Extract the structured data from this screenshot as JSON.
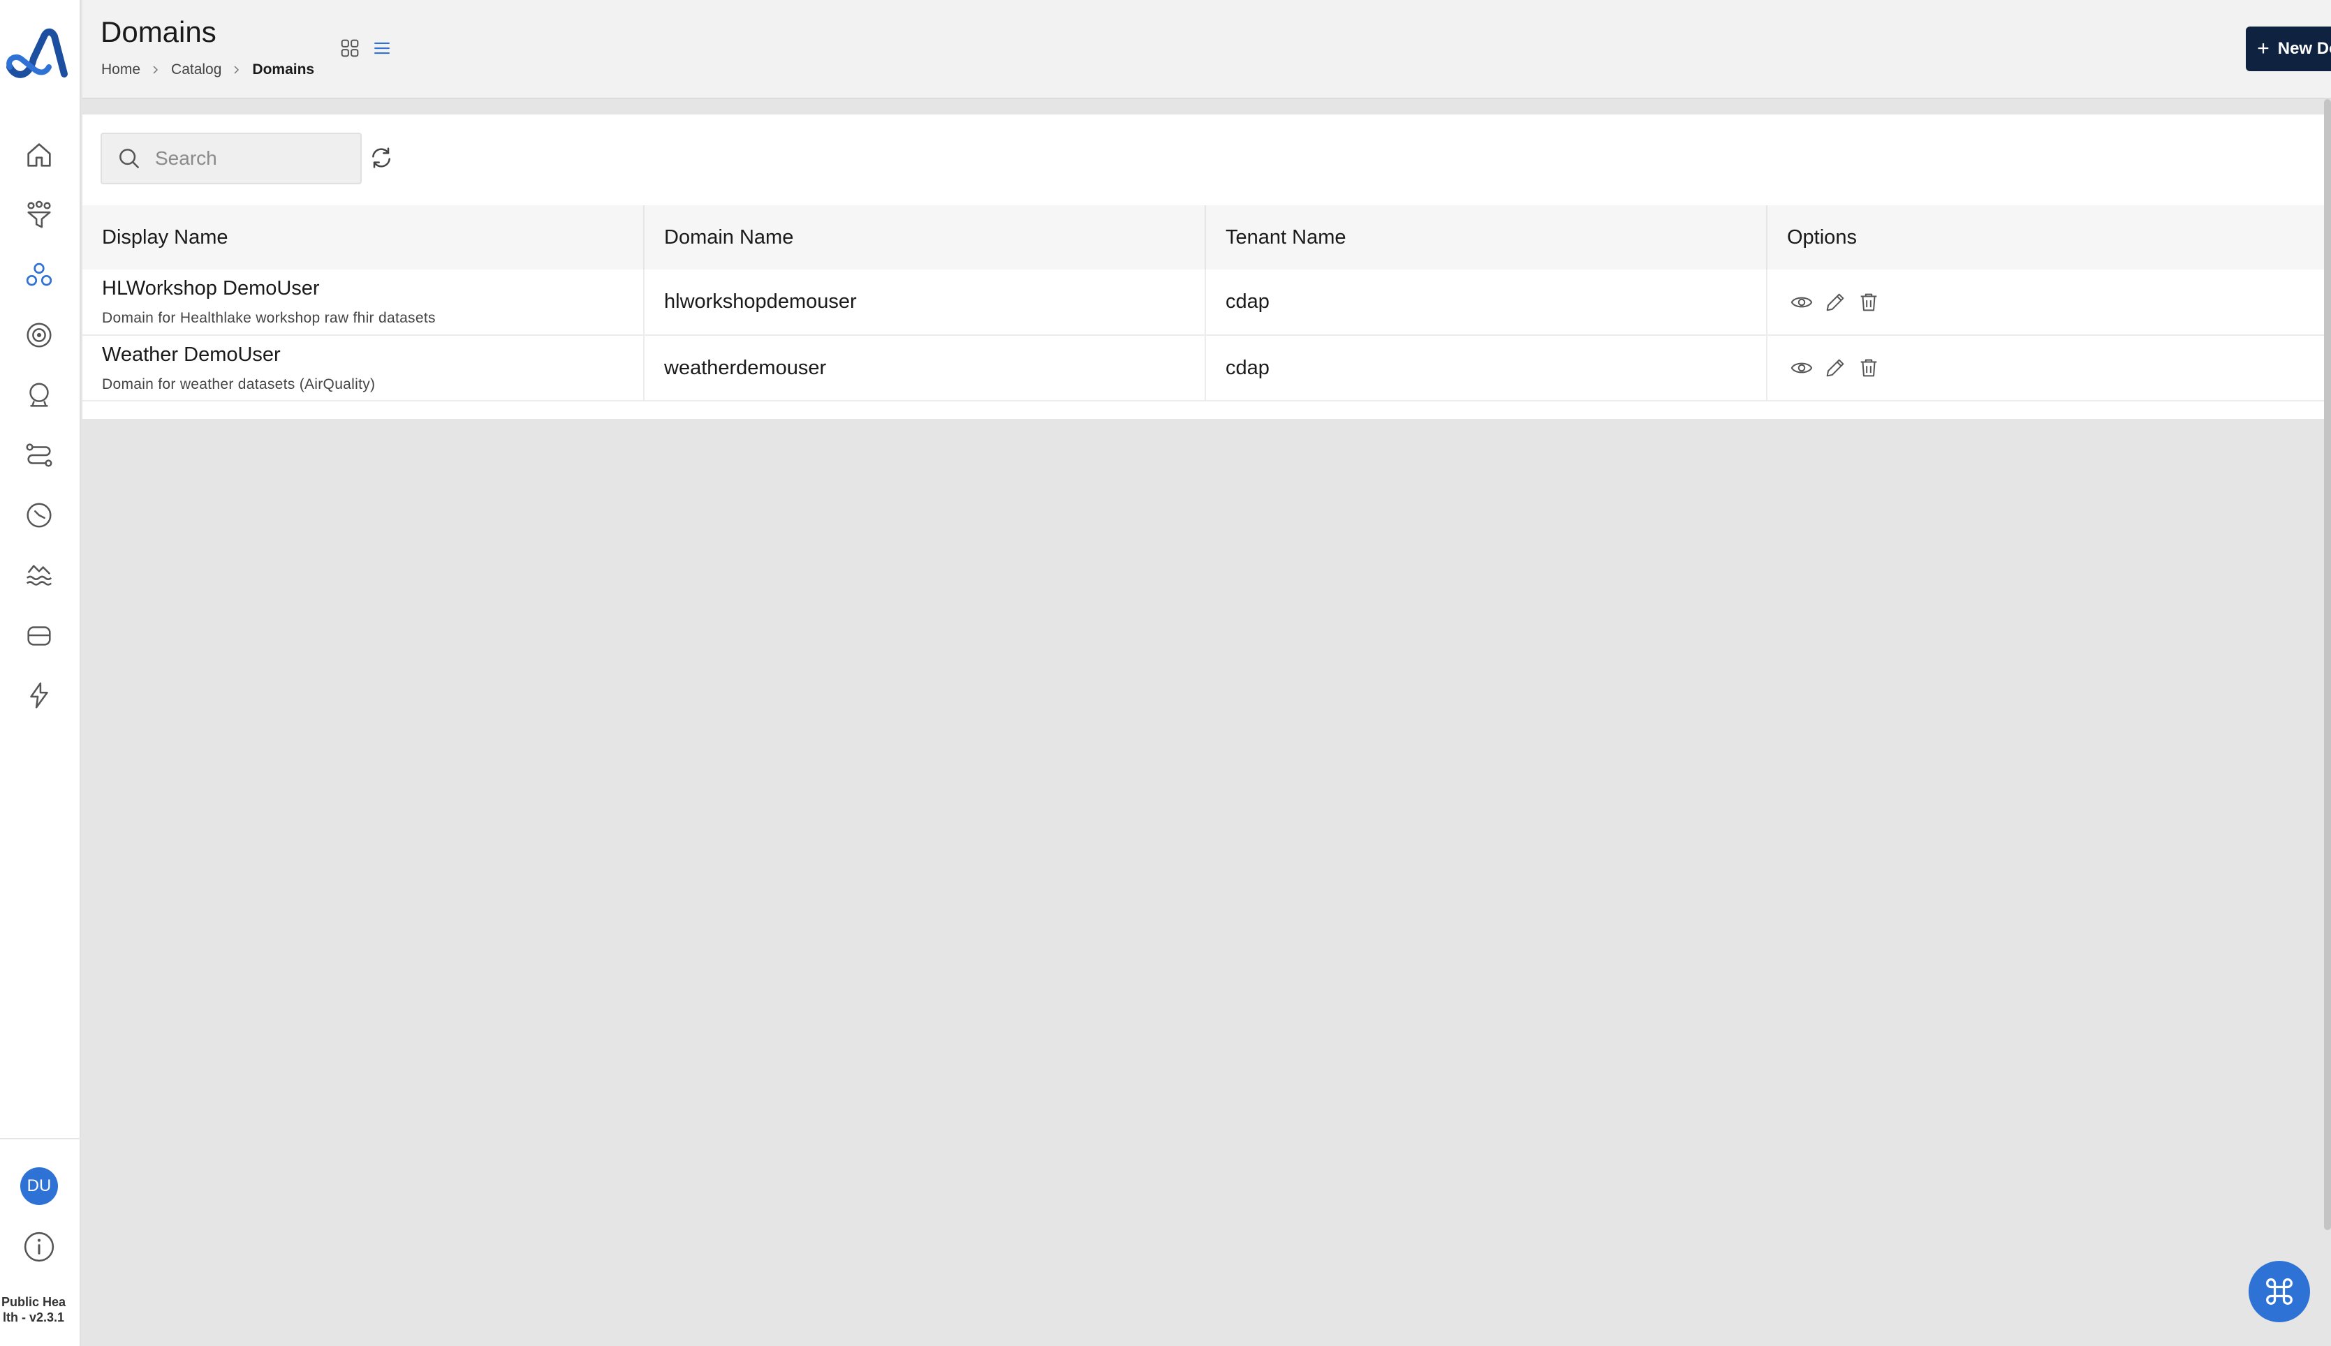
{
  "app": {
    "version_label": "Public Health - v2.3.1",
    "user_initials": "DU"
  },
  "sidebar": {
    "items": [
      {
        "icon": "home-icon",
        "active": false
      },
      {
        "icon": "funnel-people-icon",
        "active": false
      },
      {
        "icon": "domains-icon",
        "active": true
      },
      {
        "icon": "target-icon",
        "active": false
      },
      {
        "icon": "crystal-ball-icon",
        "active": false
      },
      {
        "icon": "workflow-icon",
        "active": false
      },
      {
        "icon": "clock-icon",
        "active": false
      },
      {
        "icon": "data-lake-icon",
        "active": false
      },
      {
        "icon": "storage-icon",
        "active": false
      },
      {
        "icon": "lightning-icon",
        "active": false
      }
    ]
  },
  "header": {
    "title": "Domains",
    "breadcrumb": [
      "Home",
      "Catalog",
      "Domains"
    ],
    "new_button_label": "New Domain",
    "view_modes": [
      "grid",
      "list"
    ],
    "active_view": "list"
  },
  "search": {
    "placeholder": "Search",
    "value": ""
  },
  "table": {
    "columns": [
      "Display Name",
      "Domain Name",
      "Tenant Name",
      "Options"
    ],
    "rows": [
      {
        "display_name": "HLWorkshop DemoUser",
        "description": "Domain for Healthlake workshop raw fhir datasets",
        "domain_name": "hlworkshopdemouser",
        "tenant_name": "cdap"
      },
      {
        "display_name": "Weather DemoUser",
        "description": "Domain for weather datasets (AirQuality)",
        "domain_name": "weatherdemouser",
        "tenant_name": "cdap"
      }
    ]
  },
  "colors": {
    "primary_button": "#0f2340",
    "accent_blue": "#2f72d6",
    "page_background": "#e5e5e5"
  }
}
